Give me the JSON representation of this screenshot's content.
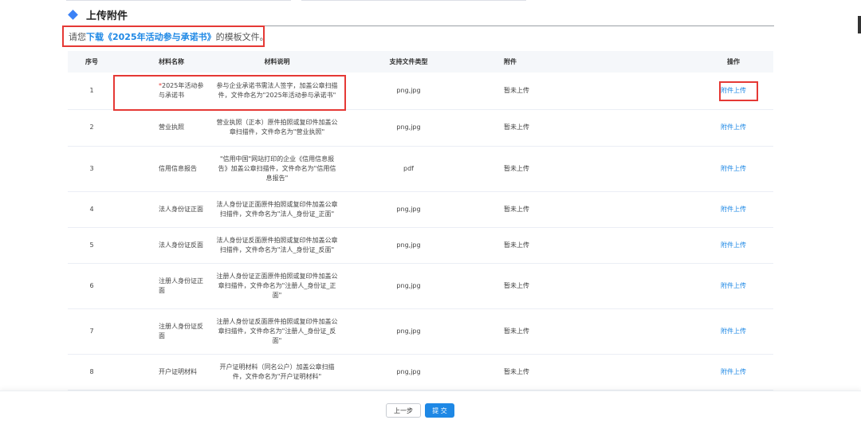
{
  "section": {
    "title": "上传附件"
  },
  "notice": {
    "prefix": "请您",
    "link": "下载《2025年活动参与承诺书》",
    "suffix": "的模板文件。"
  },
  "table": {
    "headers": {
      "index": "序号",
      "name": "材料名称",
      "desc": "材料说明",
      "types": "支持文件类型",
      "attachment": "附件",
      "action": "操作"
    },
    "rows": [
      {
        "index": "1",
        "required_mark": "*",
        "name": "2025年活动参与承诺书",
        "desc": "参与企业承诺书需法人签字，加盖公章扫描件，文件命名为\"2025年活动参与承诺书\"",
        "types": "png,jpg",
        "status": "暂未上传",
        "action": "附件上传"
      },
      {
        "index": "2",
        "required_mark": "",
        "name": "营业执照",
        "desc": "营业执照（正本）原件拍照或复印件加盖公章扫描件，文件命名为\"营业执照\"",
        "types": "png,jpg",
        "status": "暂未上传",
        "action": "附件上传"
      },
      {
        "index": "3",
        "required_mark": "",
        "name": "信用信息报告",
        "desc": "\"信用中国\"网站打印的企业《信用信息报告》加盖公章扫描件，文件命名为\"信用信息报告\"",
        "types": "pdf",
        "status": "暂未上传",
        "action": "附件上传"
      },
      {
        "index": "4",
        "required_mark": "",
        "name": "法人身份证正面",
        "desc": "法人身份证正面原件拍照或复印件加盖公章扫描件，文件命名为\"法人_身份证_正面\"",
        "types": "png,jpg",
        "status": "暂未上传",
        "action": "附件上传"
      },
      {
        "index": "5",
        "required_mark": "",
        "name": "法人身份证反面",
        "desc": "法人身份证反面原件拍照或复印件加盖公章扫描件，文件命名为\"法人_身份证_反面\"",
        "types": "png,jpg",
        "status": "暂未上传",
        "action": "附件上传"
      },
      {
        "index": "6",
        "required_mark": "",
        "name": "注册人身份证正面",
        "desc": "注册人身份证正面原件拍照或复印件加盖公章扫描件，文件命名为\"注册人_身份证_正面\"",
        "types": "png,jpg",
        "status": "暂未上传",
        "action": "附件上传"
      },
      {
        "index": "7",
        "required_mark": "",
        "name": "注册人身份证反面",
        "desc": "注册人身份证反面原件拍照或复印件加盖公章扫描件，文件命名为\"注册人_身份证_反面\"",
        "types": "png,jpg",
        "status": "暂未上传",
        "action": "附件上传"
      },
      {
        "index": "8",
        "required_mark": "",
        "name": "开户证明材料",
        "desc": "开户证明材料（同名公户）加盖公章扫描件，文件命名为\"开户证明材料\"",
        "types": "png,jpg",
        "status": "暂未上传",
        "action": "附件上传"
      }
    ]
  },
  "footer": {
    "prev_label": "上一步",
    "submit_label": "提 交"
  },
  "colors": {
    "accent": "#1e88e5",
    "highlight": "#e53935"
  },
  "icons": {
    "section_marker": "diamond-icon"
  }
}
